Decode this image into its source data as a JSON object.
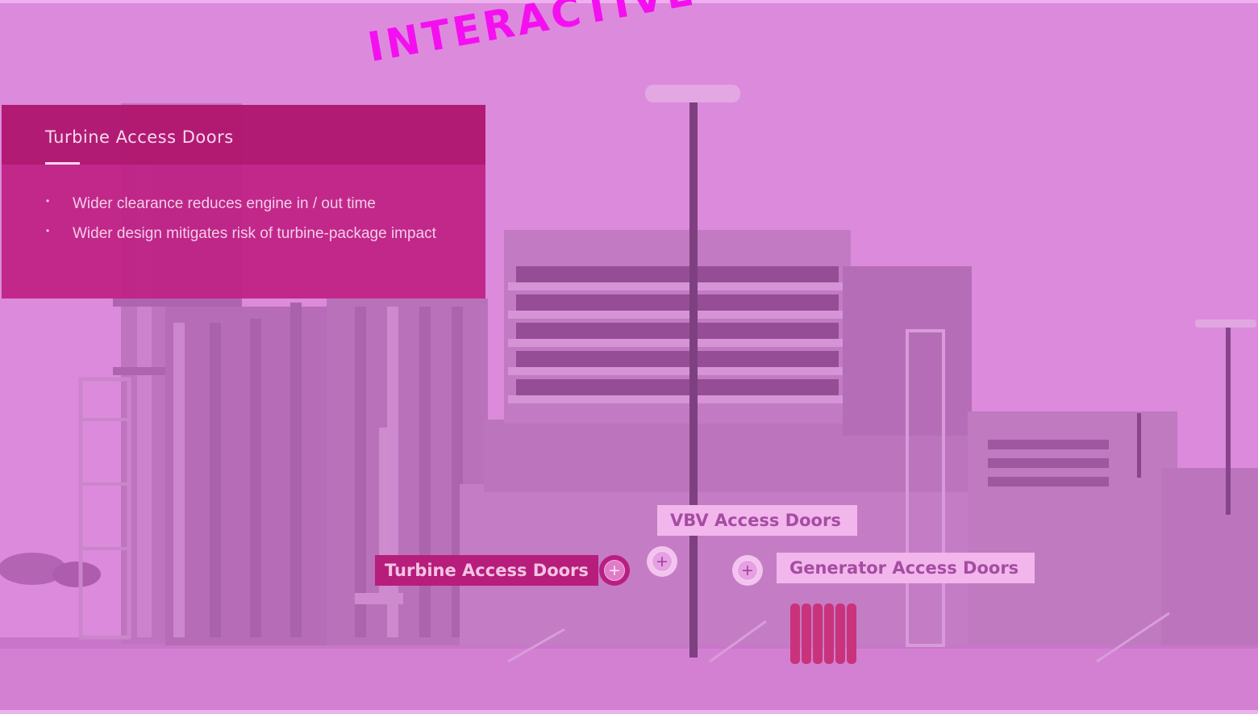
{
  "banner": {
    "text": "INTERACTIVE G"
  },
  "info_panel": {
    "title": "Turbine Access Doors",
    "bullets": [
      "Wider clearance reduces engine in / out time",
      "Wider design mitigates risk of turbine-package impact"
    ]
  },
  "hotspots": {
    "turbine": {
      "label": "Turbine Access Doors",
      "icon": "plus-icon",
      "state": "selected"
    },
    "vbv": {
      "label": "VBV Access Doors",
      "icon": "plus-icon",
      "state": "idle"
    },
    "generator": {
      "label": "Generator Access Doors",
      "icon": "plus-icon",
      "state": "idle"
    }
  },
  "colors": {
    "background_tint": "#d98ad8",
    "banner_text": "#f40ff0",
    "panel": "#be2082",
    "active_label": "#b71d7b",
    "idle_label": "#f2b6ec"
  }
}
